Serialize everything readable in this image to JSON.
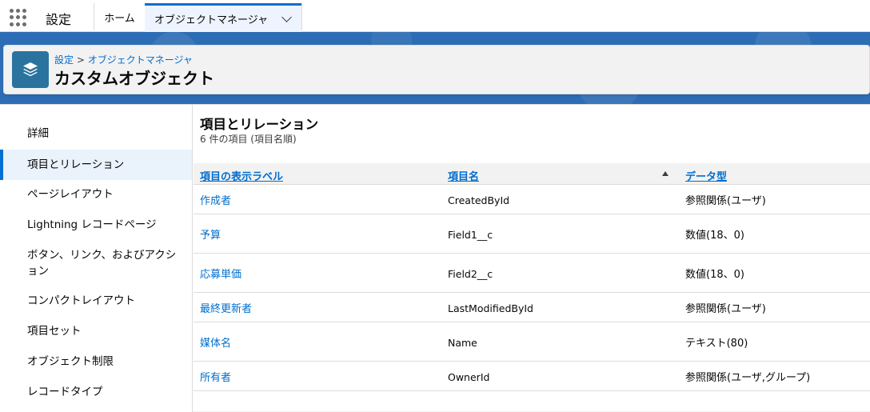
{
  "topnav": {
    "app_name": "設定",
    "tabs": [
      {
        "label": "ホーム"
      },
      {
        "label": "オブジェクトマネージャ"
      }
    ]
  },
  "header": {
    "breadcrumb": {
      "root": "設定",
      "separator": " > ",
      "current": "オブジェクトマネージャ"
    },
    "title": "カスタムオブジェクト",
    "icon": "stack-layers-icon",
    "icon_color": "#2a739e"
  },
  "sidebar": {
    "items": [
      {
        "label": "詳細"
      },
      {
        "label": "項目とリレーション",
        "active": true
      },
      {
        "label": "ページレイアウト"
      },
      {
        "label": "Lightning レコードページ"
      },
      {
        "label": "ボタン、リンク、およびアクション"
      },
      {
        "label": "コンパクトレイアウト"
      },
      {
        "label": "項目セット"
      },
      {
        "label": "オブジェクト制限"
      },
      {
        "label": "レコードタイプ"
      }
    ]
  },
  "main": {
    "title": "項目とリレーション",
    "subtitle": "6 件の項目 (項目名順)",
    "columns": {
      "label": "項目の表示ラベル",
      "api": "項目名",
      "type": "データ型"
    },
    "sort": {
      "column": "項目名",
      "direction": "asc"
    },
    "rows": [
      {
        "label": "作成者",
        "api": "CreatedById",
        "type": "参照関係(ユーザ)"
      },
      {
        "label": "予算",
        "api": "Field1__c",
        "type": "数値(18、0)"
      },
      {
        "label": "応募単価",
        "api": "Field2__c",
        "type": "数値(18、0)"
      },
      {
        "label": "最終更新者",
        "api": "LastModifiedById",
        "type": "参照関係(ユーザ)"
      },
      {
        "label": "媒体名",
        "api": "Name",
        "type": "テキスト(80)"
      },
      {
        "label": "所有者",
        "api": "OwnerId",
        "type": "参照関係(ユーザ,グループ)"
      }
    ]
  },
  "colors": {
    "accent": "#0070d2",
    "link": "#006dcc",
    "banner": "#2d6db5",
    "active_bg": "#eaf2fc"
  }
}
